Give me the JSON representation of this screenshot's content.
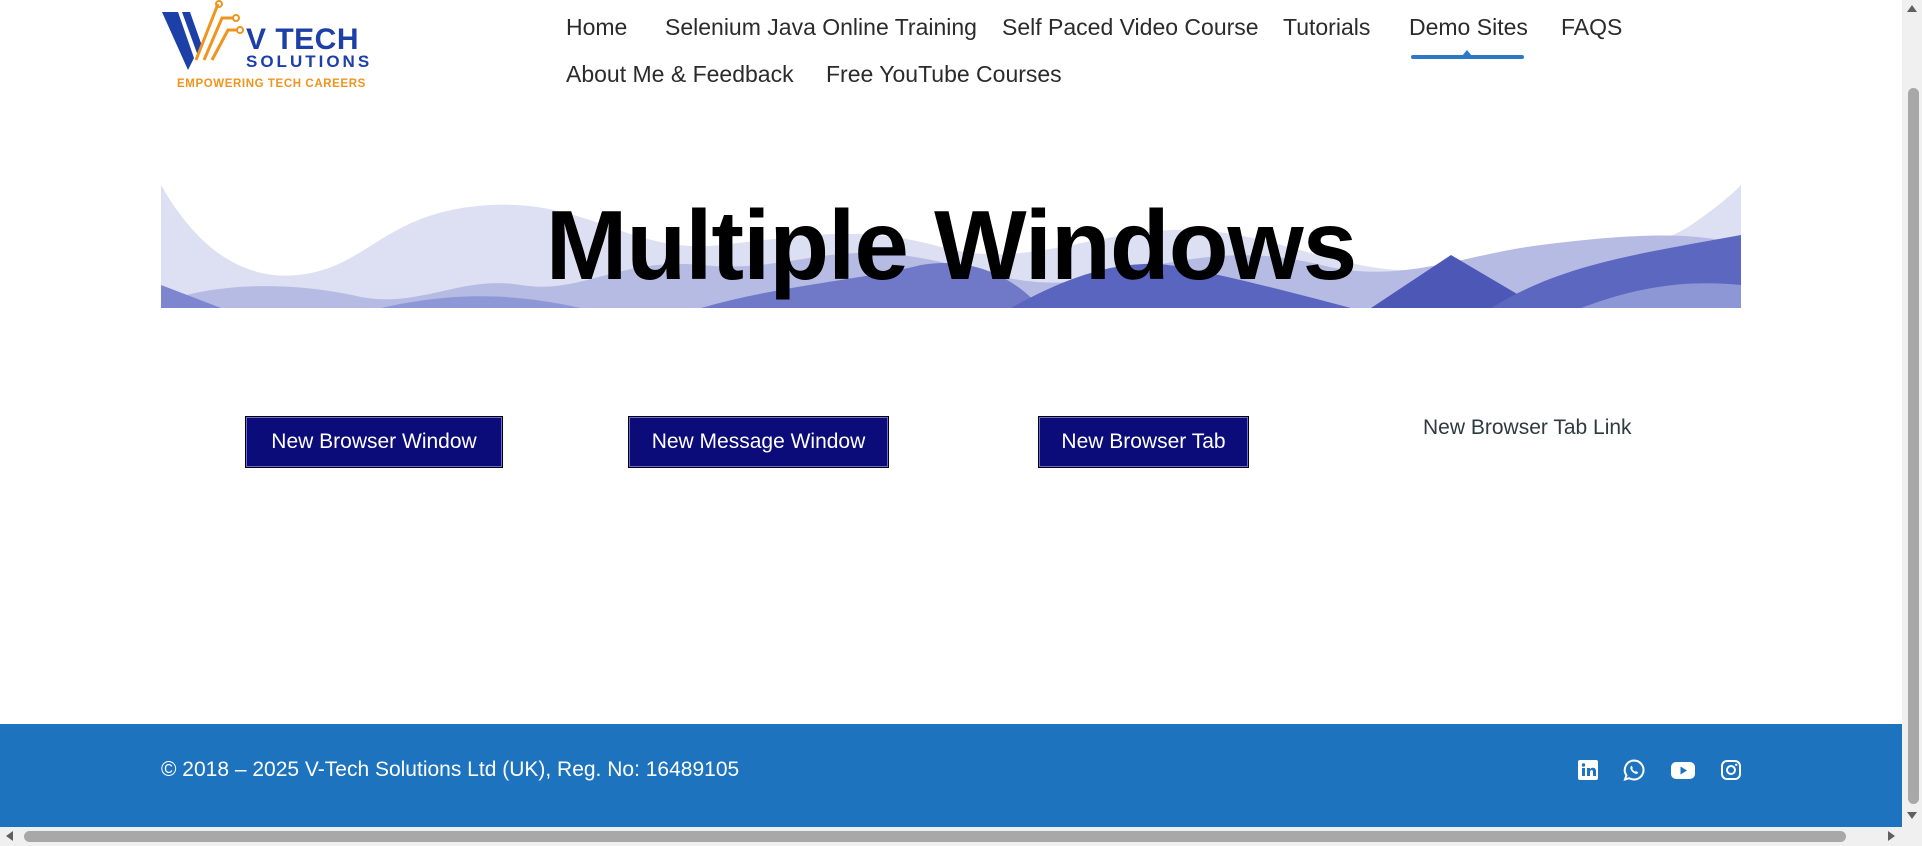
{
  "logo": {
    "brand": "V TECH",
    "sub": "SOLUTIONS",
    "tagline": "EMPOWERING TECH CAREERS"
  },
  "nav": {
    "items": [
      {
        "label": "Home"
      },
      {
        "label": "Selenium Java Online Training"
      },
      {
        "label": "Self Paced Video Course"
      },
      {
        "label": "Tutorials"
      },
      {
        "label": "Demo Sites",
        "active": true
      },
      {
        "label": "FAQS"
      },
      {
        "label": "About Me & Feedback"
      },
      {
        "label": "Free YouTube Courses"
      }
    ]
  },
  "hero": {
    "title": "Multiple Windows"
  },
  "buttons": {
    "new_browser_window": "New Browser Window",
    "new_message_window": "New Message Window",
    "new_browser_tab": "New Browser Tab",
    "new_browser_tab_link": "New Browser Tab Link"
  },
  "footer": {
    "copyright": "© 2018 – 2025 V-Tech Solutions Ltd (UK), Reg. No: 16489105",
    "social_icons": [
      "linkedin-icon",
      "whatsapp-icon",
      "youtube-icon",
      "instagram-icon"
    ]
  },
  "colors": {
    "brand_blue": "#1c3fa8",
    "brand_orange": "#f0941e",
    "nav_accent": "#2c79c8",
    "button_bg": "#0b0b7a",
    "footer_bg": "#1e73be"
  }
}
